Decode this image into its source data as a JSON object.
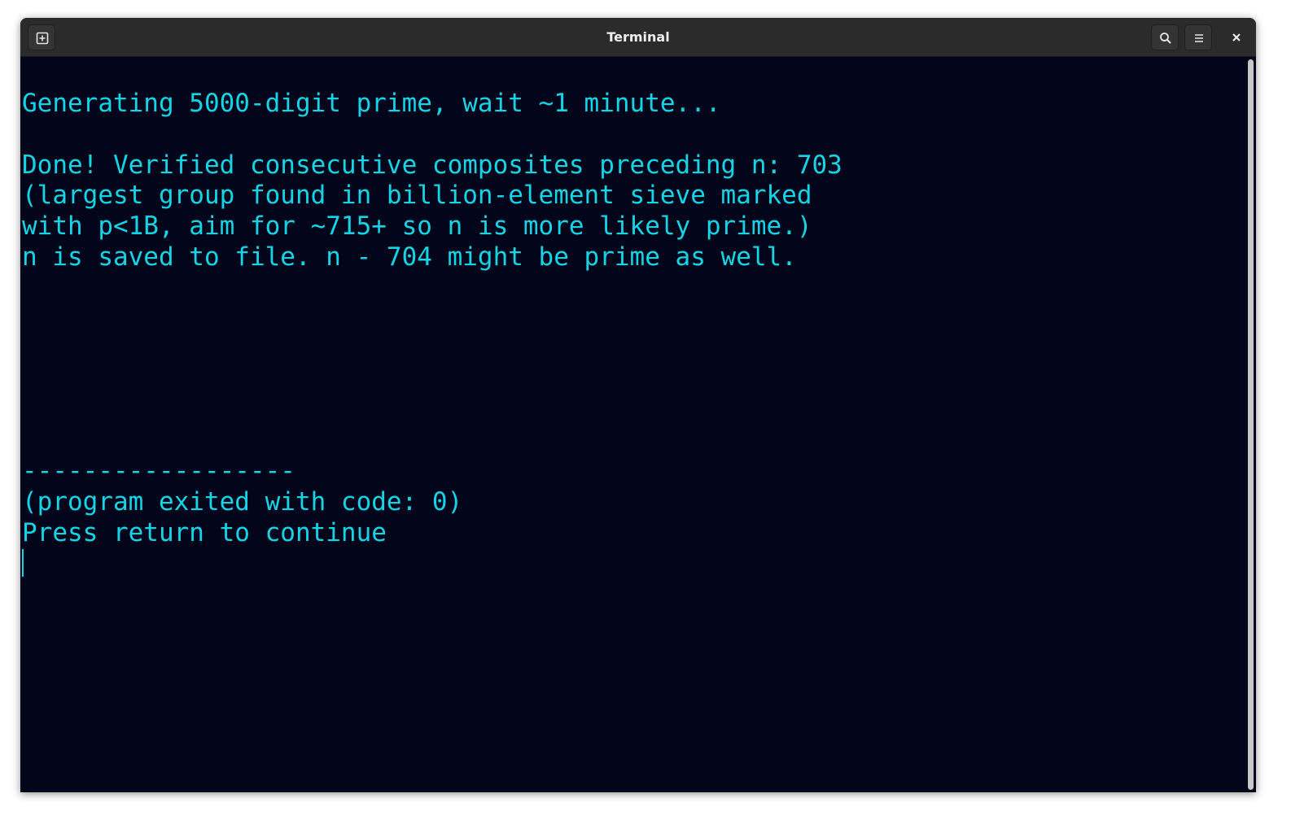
{
  "window": {
    "title": "Terminal"
  },
  "titlebar": {
    "new_tab_icon": "new-tab-icon",
    "search_icon": "search-icon",
    "menu_icon": "hamburger-menu-icon",
    "close_icon": "close-icon"
  },
  "terminal": {
    "lines": [
      "Generating 5000-digit prime, wait ~1 minute...",
      "",
      "Done! Verified consecutive composites preceding n: 703",
      "(largest group found in billion-element sieve marked",
      "with p<1B, aim for ~715+ so n is more likely prime.)",
      "n is saved to file. n - 704 might be prime as well.",
      "",
      "",
      "",
      "",
      "",
      "",
      "",
      "------------------",
      "(program exited with code: 0)",
      "Press return to continue"
    ],
    "text_color": "#14d4e6",
    "background_color": "#03061a"
  }
}
